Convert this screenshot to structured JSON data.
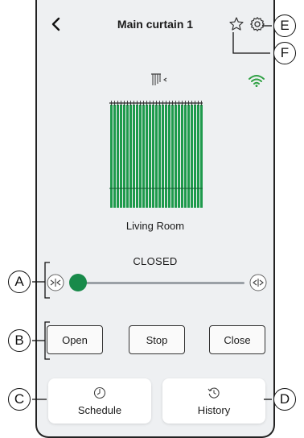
{
  "header": {
    "title": "Main curtain 1"
  },
  "device": {
    "room": "Living Room",
    "status": "CLOSED"
  },
  "actions": {
    "open": "Open",
    "stop": "Stop",
    "close": "Close"
  },
  "cards": {
    "schedule": "Schedule",
    "history": "History"
  },
  "callouts": {
    "a": "A",
    "b": "B",
    "c": "C",
    "d": "D",
    "e": "E",
    "f": "F"
  },
  "slider": {
    "position_percent": 0
  },
  "colors": {
    "accent": "#188a4a",
    "curtain": "#1e9a4c",
    "wifi": "#2ea043",
    "background": "#eef0f2"
  },
  "icons": [
    "back-icon",
    "star-icon",
    "gear-icon",
    "curtain-icon",
    "wifi-icon",
    "slider-close-icon",
    "slider-open-icon",
    "schedule-icon",
    "history-icon"
  ]
}
